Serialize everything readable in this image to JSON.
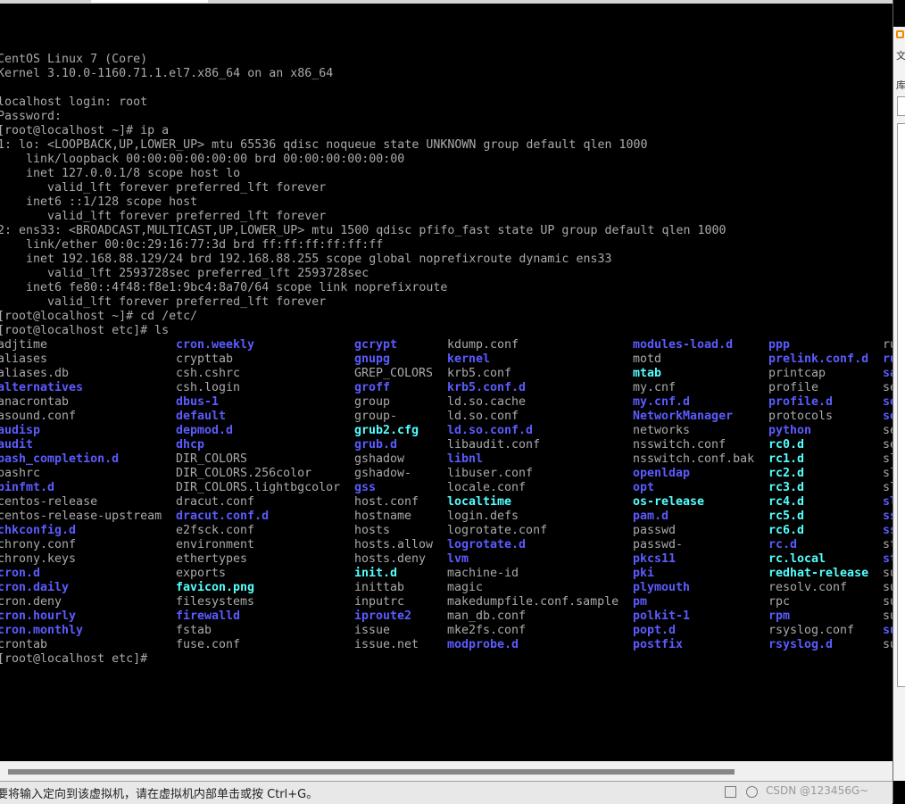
{
  "terminal": {
    "lines": [
      "CentOS Linux 7 (Core)",
      "Kernel 3.10.0-1160.71.1.el7.x86_64 on an x86_64",
      "",
      "localhost login: root",
      "Password:",
      "[root@localhost ~]# ip a",
      "1: lo: <LOOPBACK,UP,LOWER_UP> mtu 65536 qdisc noqueue state UNKNOWN group default qlen 1000",
      "    link/loopback 00:00:00:00:00:00 brd 00:00:00:00:00:00",
      "    inet 127.0.0.1/8 scope host lo",
      "       valid_lft forever preferred_lft forever",
      "    inet6 ::1/128 scope host",
      "       valid_lft forever preferred_lft forever",
      "2: ens33: <BROADCAST,MULTICAST,UP,LOWER_UP> mtu 1500 qdisc pfifo_fast state UP group default qlen 1000",
      "    link/ether 00:0c:29:16:77:3d brd ff:ff:ff:ff:ff:ff",
      "    inet 192.168.88.129/24 brd 192.168.88.255 scope global noprefixroute dynamic ens33",
      "       valid_lft 2593728sec preferred_lft 2593728sec",
      "    inet6 fe80::4f48:f8e1:9bc4:8a70/64 scope link noprefixroute",
      "       valid_lft forever preferred_lft forever",
      "[root@localhost ~]# cd /etc/",
      "[root@localhost etc]# ls"
    ],
    "final_prompt": "[root@localhost etc]#",
    "colors": {
      "file": "#aaaaaa",
      "dir": "#5b5bff",
      "link": "#55ffff",
      "background": "#000000"
    },
    "ls_columns": [
      [
        [
          "adjtime",
          "file"
        ],
        [
          "aliases",
          "file"
        ],
        [
          "aliases.db",
          "file"
        ],
        [
          "alternatives",
          "dir"
        ],
        [
          "anacrontab",
          "file"
        ],
        [
          "asound.conf",
          "file"
        ],
        [
          "audisp",
          "dir"
        ],
        [
          "audit",
          "dir"
        ],
        [
          "bash_completion.d",
          "dir"
        ],
        [
          "bashrc",
          "file"
        ],
        [
          "binfmt.d",
          "dir"
        ],
        [
          "centos-release",
          "file"
        ],
        [
          "centos-release-upstream",
          "file"
        ],
        [
          "chkconfig.d",
          "dir"
        ],
        [
          "chrony.conf",
          "file"
        ],
        [
          "chrony.keys",
          "file"
        ],
        [
          "cron.d",
          "dir"
        ],
        [
          "cron.daily",
          "dir"
        ],
        [
          "cron.deny",
          "file"
        ],
        [
          "cron.hourly",
          "dir"
        ],
        [
          "cron.monthly",
          "dir"
        ],
        [
          "crontab",
          "file"
        ]
      ],
      [
        [
          "cron.weekly",
          "dir"
        ],
        [
          "crypttab",
          "file"
        ],
        [
          "csh.cshrc",
          "file"
        ],
        [
          "csh.login",
          "file"
        ],
        [
          "dbus-1",
          "dir"
        ],
        [
          "default",
          "dir"
        ],
        [
          "depmod.d",
          "dir"
        ],
        [
          "dhcp",
          "dir"
        ],
        [
          "DIR_COLORS",
          "file"
        ],
        [
          "DIR_COLORS.256color",
          "file"
        ],
        [
          "DIR_COLORS.lightbgcolor",
          "file"
        ],
        [
          "dracut.conf",
          "file"
        ],
        [
          "dracut.conf.d",
          "dir"
        ],
        [
          "e2fsck.conf",
          "file"
        ],
        [
          "environment",
          "file"
        ],
        [
          "ethertypes",
          "file"
        ],
        [
          "exports",
          "file"
        ],
        [
          "favicon.png",
          "link"
        ],
        [
          "filesystems",
          "file"
        ],
        [
          "firewalld",
          "dir"
        ],
        [
          "fstab",
          "file"
        ],
        [
          "fuse.conf",
          "file"
        ]
      ],
      [
        [
          "gcrypt",
          "dir"
        ],
        [
          "gnupg",
          "dir"
        ],
        [
          "GREP_COLORS",
          "file"
        ],
        [
          "groff",
          "dir"
        ],
        [
          "group",
          "file"
        ],
        [
          "group-",
          "file"
        ],
        [
          "grub2.cfg",
          "link"
        ],
        [
          "grub.d",
          "dir"
        ],
        [
          "gshadow",
          "file"
        ],
        [
          "gshadow-",
          "file"
        ],
        [
          "gss",
          "dir"
        ],
        [
          "host.conf",
          "file"
        ],
        [
          "hostname",
          "file"
        ],
        [
          "hosts",
          "file"
        ],
        [
          "hosts.allow",
          "file"
        ],
        [
          "hosts.deny",
          "file"
        ],
        [
          "init.d",
          "link"
        ],
        [
          "inittab",
          "file"
        ],
        [
          "inputrc",
          "file"
        ],
        [
          "iproute2",
          "dir"
        ],
        [
          "issue",
          "file"
        ],
        [
          "issue.net",
          "file"
        ]
      ],
      [
        [
          "kdump.conf",
          "file"
        ],
        [
          "kernel",
          "dir"
        ],
        [
          "krb5.conf",
          "file"
        ],
        [
          "krb5.conf.d",
          "dir"
        ],
        [
          "ld.so.cache",
          "file"
        ],
        [
          "ld.so.conf",
          "file"
        ],
        [
          "ld.so.conf.d",
          "dir"
        ],
        [
          "libaudit.conf",
          "file"
        ],
        [
          "libnl",
          "dir"
        ],
        [
          "libuser.conf",
          "file"
        ],
        [
          "locale.conf",
          "file"
        ],
        [
          "localtime",
          "link"
        ],
        [
          "login.defs",
          "file"
        ],
        [
          "logrotate.conf",
          "file"
        ],
        [
          "logrotate.d",
          "dir"
        ],
        [
          "lvm",
          "dir"
        ],
        [
          "machine-id",
          "file"
        ],
        [
          "magic",
          "file"
        ],
        [
          "makedumpfile.conf.sample",
          "file"
        ],
        [
          "man_db.conf",
          "file"
        ],
        [
          "mke2fs.conf",
          "file"
        ],
        [
          "modprobe.d",
          "dir"
        ]
      ],
      [
        [
          "modules-load.d",
          "dir"
        ],
        [
          "motd",
          "file"
        ],
        [
          "mtab",
          "link"
        ],
        [
          "my.cnf",
          "file"
        ],
        [
          "my.cnf.d",
          "dir"
        ],
        [
          "NetworkManager",
          "dir"
        ],
        [
          "networks",
          "file"
        ],
        [
          "nsswitch.conf",
          "file"
        ],
        [
          "nsswitch.conf.bak",
          "file"
        ],
        [
          "openldap",
          "dir"
        ],
        [
          "opt",
          "dir"
        ],
        [
          "os-release",
          "link"
        ],
        [
          "pam.d",
          "dir"
        ],
        [
          "passwd",
          "file"
        ],
        [
          "passwd-",
          "file"
        ],
        [
          "pkcs11",
          "dir"
        ],
        [
          "pki",
          "dir"
        ],
        [
          "plymouth",
          "dir"
        ],
        [
          "pm",
          "dir"
        ],
        [
          "polkit-1",
          "dir"
        ],
        [
          "popt.d",
          "dir"
        ],
        [
          "postfix",
          "dir"
        ]
      ],
      [
        [
          "ppp",
          "dir"
        ],
        [
          "prelink.conf.d",
          "dir"
        ],
        [
          "printcap",
          "file"
        ],
        [
          "profile",
          "file"
        ],
        [
          "profile.d",
          "dir"
        ],
        [
          "protocols",
          "file"
        ],
        [
          "python",
          "dir"
        ],
        [
          "rc0.d",
          "link"
        ],
        [
          "rc1.d",
          "link"
        ],
        [
          "rc2.d",
          "link"
        ],
        [
          "rc3.d",
          "link"
        ],
        [
          "rc4.d",
          "link"
        ],
        [
          "rc5.d",
          "link"
        ],
        [
          "rc6.d",
          "link"
        ],
        [
          "rc.d",
          "dir"
        ],
        [
          "rc.local",
          "link"
        ],
        [
          "redhat-release",
          "link"
        ],
        [
          "resolv.conf",
          "file"
        ],
        [
          "rpc",
          "file"
        ],
        [
          "rpm",
          "dir"
        ],
        [
          "rsyslog.conf",
          "file"
        ],
        [
          "rsyslog.d",
          "dir"
        ]
      ],
      [
        [
          "ru",
          "file"
        ],
        [
          "ru",
          "dir"
        ],
        [
          "sa",
          "dir"
        ],
        [
          "se",
          "file"
        ],
        [
          "se",
          "dir"
        ],
        [
          "se",
          "dir"
        ],
        [
          "se",
          "file"
        ],
        [
          "se",
          "file"
        ],
        [
          "sl",
          "file"
        ],
        [
          "sl",
          "file"
        ],
        [
          "sl",
          "file"
        ],
        [
          "sl",
          "dir"
        ],
        [
          "ss",
          "dir"
        ],
        [
          "ss",
          "dir"
        ],
        [
          "st",
          "file"
        ],
        [
          "st",
          "dir"
        ],
        [
          "su",
          "file"
        ],
        [
          "su",
          "file"
        ],
        [
          "su",
          "file"
        ],
        [
          "su",
          "file"
        ],
        [
          "su",
          "dir"
        ],
        [
          "su",
          "file"
        ]
      ]
    ]
  },
  "statusbar": {
    "message": "要将输入定向到该虚拟机，请在虚拟机内部单击或按 Ctrl+G。",
    "watermark": "CSDN @123456G~"
  },
  "right_window": {
    "chars": [
      "文",
      "库"
    ]
  }
}
